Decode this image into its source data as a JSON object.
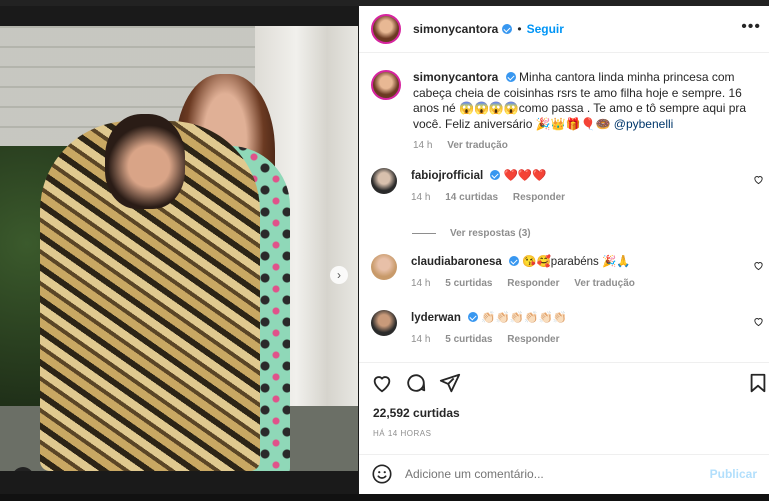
{
  "post": {
    "author": "simonycantora",
    "follow_label": "Seguir",
    "more_label": "•••",
    "caption": "Minha cantora linda minha princesa com cabeça cheia de coisinhas rsrs te amo filha hoje e sempre. 16 anos né 😱😱😱😱como passa . Te amo e tô sempre aqui pra você. Feliz aniversário 🎉👑🎁🎈🍩",
    "caption_mention": "@pybenelli",
    "caption_time": "14 h",
    "caption_translate": "Ver tradução",
    "likes": "22,592 curtidas",
    "posted_ago": "HÁ 14 HORAS"
  },
  "comments": [
    {
      "user": "fabiojrofficial",
      "text": "❤️❤️❤️",
      "time": "14 h",
      "likes": "14 curtidas",
      "reply": "Responder",
      "translate": ""
    },
    {
      "user": "claudiabaronesa",
      "text": "😘🥰parabéns 🎉🙏",
      "time": "14 h",
      "likes": "5 curtidas",
      "reply": "Responder",
      "translate": "Ver tradução"
    },
    {
      "user": "lyderwan",
      "text": "👏🏻👏🏻👏🏻👏🏻👏🏻👏🏻",
      "time": "14 h",
      "likes": "5 curtidas",
      "reply": "Responder",
      "translate": ""
    }
  ],
  "view_replies": "Ver respostas (3)",
  "add_comment": {
    "placeholder": "Adicione um comentário...",
    "publish_label": "Publicar"
  },
  "icons": [
    "heart-icon",
    "comment-icon",
    "share-icon",
    "bookmark-icon",
    "emoji-icon",
    "user-tag-icon",
    "chevron-right-icon",
    "more-icon"
  ],
  "colors": {
    "accent": "#0095f6",
    "verified": "#3897f0",
    "muted": "#8e8e8e",
    "heart": "#e0245e"
  }
}
